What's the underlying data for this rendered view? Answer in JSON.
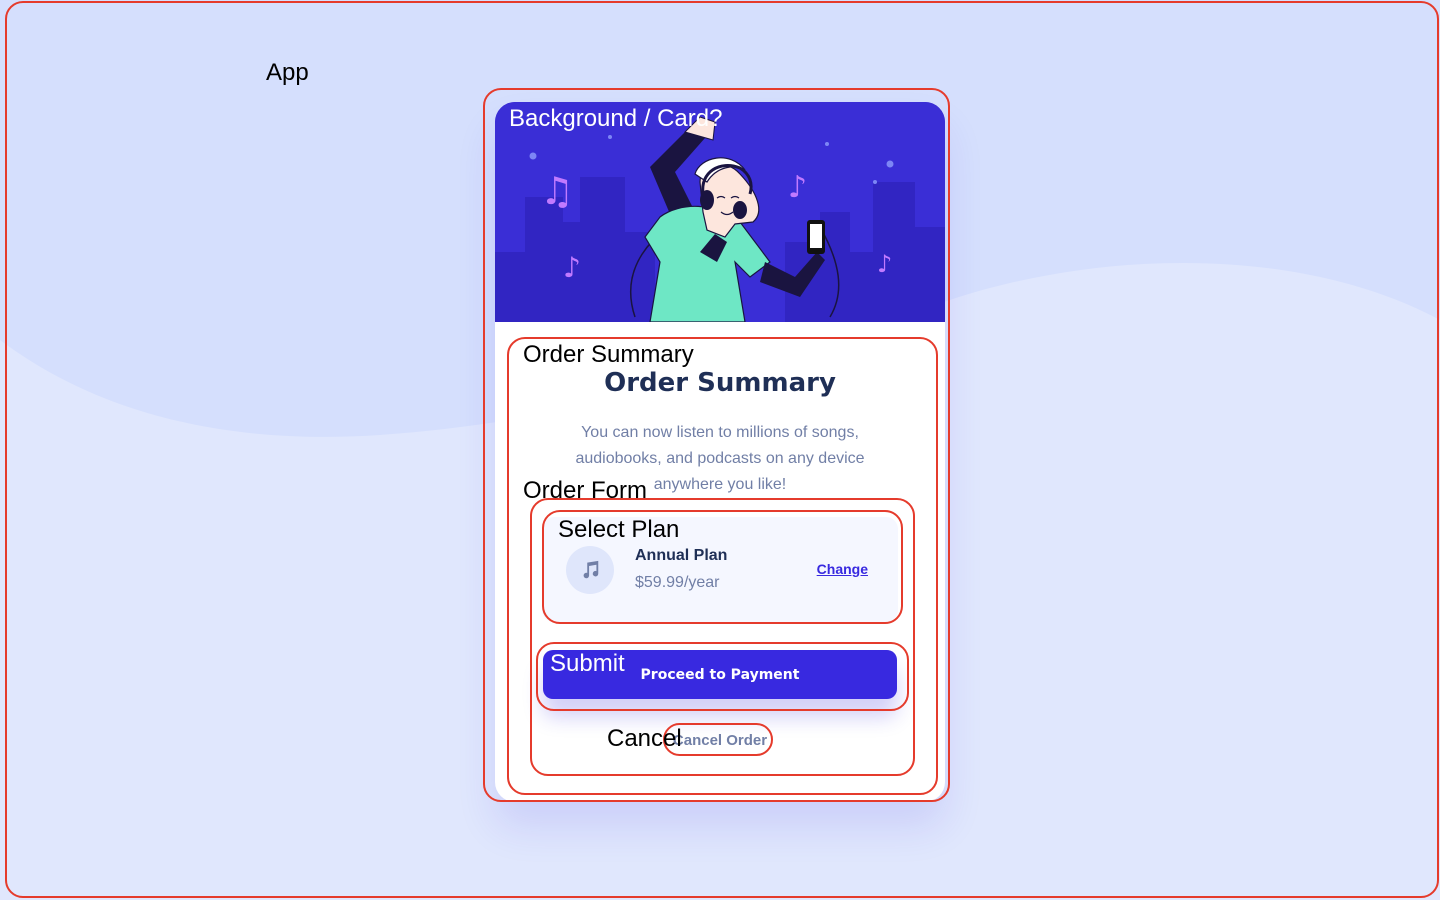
{
  "annotations": {
    "app": "App",
    "background_card": "Background / Card?",
    "order_summary": "Order Summary",
    "order_form": "Order Form",
    "select_plan": "Select Plan",
    "submit": "Submit",
    "cancel": "Cancel"
  },
  "card": {
    "title": "Order Summary",
    "description": "You can now listen to millions of songs, audiobooks, and podcasts on any device anywhere you like!",
    "plan": {
      "icon": "music-note-icon",
      "name": "Annual Plan",
      "price": "$59.99/year",
      "change_label": "Change"
    },
    "pay_label": "Proceed to Payment",
    "cancel_label": "Cancel Order"
  },
  "colors": {
    "page_background": "#e0e7fd",
    "hero_background": "#3a2ed6",
    "accent": "#3829e0",
    "title": "#1f2f56",
    "muted_text": "#717fa6",
    "outline": "#e53b2c"
  }
}
